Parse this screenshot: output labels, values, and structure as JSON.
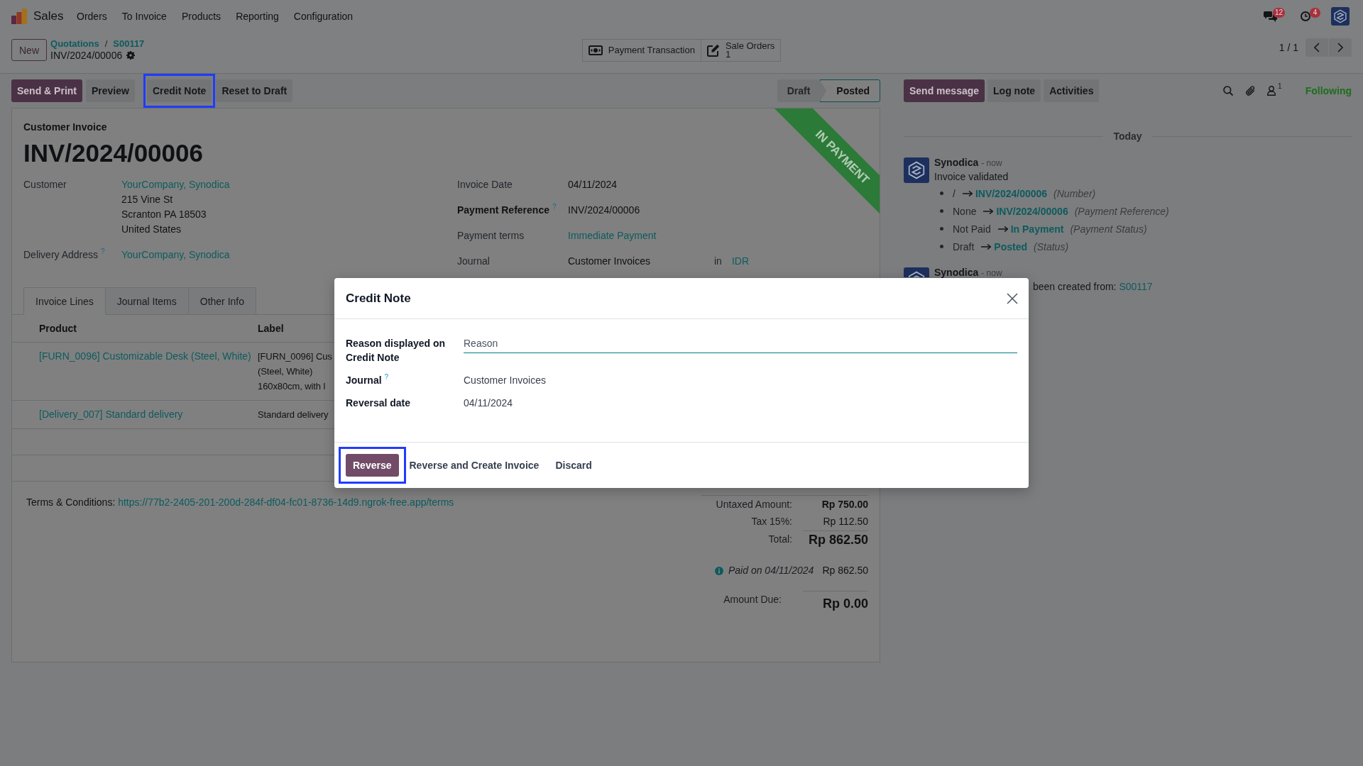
{
  "navbar": {
    "app_name": "Sales",
    "menu": [
      "Orders",
      "To Invoice",
      "Products",
      "Reporting",
      "Configuration"
    ],
    "systray": [
      {
        "kind": "messages",
        "badge": "12"
      },
      {
        "kind": "activities",
        "badge": "4"
      }
    ]
  },
  "control_panel": {
    "new_button": "New",
    "breadcrumbs": [
      "Quotations",
      "S00117"
    ],
    "separator": "/",
    "record_name": "INV/2024/00006",
    "smart_buttons": [
      {
        "kind": "payments",
        "label": "Payment Transaction"
      },
      {
        "kind": "sale_orders",
        "label": "Sale Orders",
        "count": "1"
      }
    ],
    "pager": "1 / 1"
  },
  "action_buttons": [
    {
      "label": "Send & Print",
      "primary": true,
      "highlighted": false
    },
    {
      "label": "Preview",
      "primary": false,
      "highlighted": false
    },
    {
      "label": "Credit Note",
      "primary": false,
      "highlighted": true
    },
    {
      "label": "Reset to Draft",
      "primary": false,
      "highlighted": false
    }
  ],
  "statusbar": [
    {
      "label": "Draft",
      "selected": false
    },
    {
      "label": "Posted",
      "selected": true
    }
  ],
  "form": {
    "ribbon": "IN PAYMENT",
    "move_type": "Customer Invoice",
    "name": "INV/2024/00006",
    "left_fields": [
      {
        "label": "Customer",
        "required": false,
        "link": true,
        "value": "YourCompany, Synodica",
        "address": [
          "215 Vine St",
          "Scranton PA 18503",
          "United States"
        ]
      },
      {
        "label": "Delivery Address",
        "help": "?",
        "required": false,
        "link": true,
        "value": "YourCompany, Synodica"
      }
    ],
    "right_fields": [
      {
        "label": "Invoice Date",
        "required": false,
        "link": false,
        "value": "04/11/2024"
      },
      {
        "label": "Payment Reference",
        "help": "?",
        "required": true,
        "link": false,
        "value": "INV/2024/00006"
      },
      {
        "label": "Payment terms",
        "required": false,
        "link": true,
        "value": "Immediate Payment"
      },
      {
        "label": "Journal",
        "required": false,
        "link": false,
        "value": "Customer Invoices",
        "currency_prefix": "in",
        "currency": "IDR"
      }
    ],
    "tabs": [
      {
        "label": "Invoice Lines",
        "selected": true
      },
      {
        "label": "Journal Items",
        "selected": false
      },
      {
        "label": "Other Info",
        "selected": false
      }
    ],
    "lines": {
      "columns": [
        "Product",
        "Label"
      ],
      "rows": [
        {
          "product": "[FURN_0096] Customizable Desk (Steel, White)",
          "label_lines": [
            "[FURN_0096] Cus",
            "(Steel, White)",
            "160x80cm, with l"
          ]
        },
        {
          "product": "[Delivery_007] Standard delivery",
          "label_lines": [
            "Standard delivery"
          ]
        }
      ]
    },
    "terms": {
      "label": "Terms & Conditions:",
      "url": "https://77b2-2405-201-200d-284f-df04-fc01-8736-14d9.ngrok-free.app/terms"
    },
    "totals": [
      {
        "kind": "subtotal",
        "label": "Untaxed Amount:",
        "value": "Rp 750.00"
      },
      {
        "kind": "tax",
        "label": "Tax 15%:",
        "value": "Rp 112.50"
      },
      {
        "kind": "total",
        "label": "Total:",
        "value": "Rp 862.50"
      }
    ],
    "payments": [
      {
        "text": "Paid on 04/11/2024",
        "amount": "Rp 862.50"
      }
    ],
    "amount_due": {
      "label": "Amount Due:",
      "value": "Rp 0.00"
    }
  },
  "chatter": {
    "buttons": [
      {
        "label": "Send message",
        "primary": true
      },
      {
        "label": "Log note",
        "primary": false
      },
      {
        "label": "Activities",
        "primary": false
      }
    ],
    "followers_count": "1",
    "follow_status": "Following",
    "day": "Today",
    "messages": [
      {
        "kind": "tracking",
        "author": "Synodica",
        "time": "- now",
        "body": "Invoice validated",
        "changes": [
          {
            "old": "/",
            "new": "INV/2024/00006",
            "field": "(Number)"
          },
          {
            "old": "None",
            "new": "INV/2024/00006",
            "field": "(Payment Reference)"
          },
          {
            "old": "Not Paid",
            "new": "In Payment",
            "field": "(Payment Status)"
          },
          {
            "old": "Draft",
            "new": "Posted",
            "field": "(Status)"
          }
        ]
      },
      {
        "kind": "note",
        "author": "Synodica",
        "time": "- now",
        "body": "been created from:",
        "link": "S00117"
      }
    ]
  },
  "dialog": {
    "title": "Credit Note",
    "fields": [
      {
        "kind": "input",
        "label": "Reason displayed on Credit Note",
        "placeholder": "Reason"
      },
      {
        "kind": "text",
        "label": "Journal",
        "help": "?",
        "value": "Customer Invoices"
      },
      {
        "kind": "text",
        "label": "Reversal date",
        "value": "04/11/2024"
      }
    ],
    "buttons": [
      {
        "label": "Reverse",
        "primary": true,
        "highlighted": true
      },
      {
        "label": "Reverse and Create Invoice",
        "primary": false,
        "highlighted": false
      },
      {
        "label": "Discard",
        "primary": false,
        "highlighted": false
      }
    ]
  }
}
